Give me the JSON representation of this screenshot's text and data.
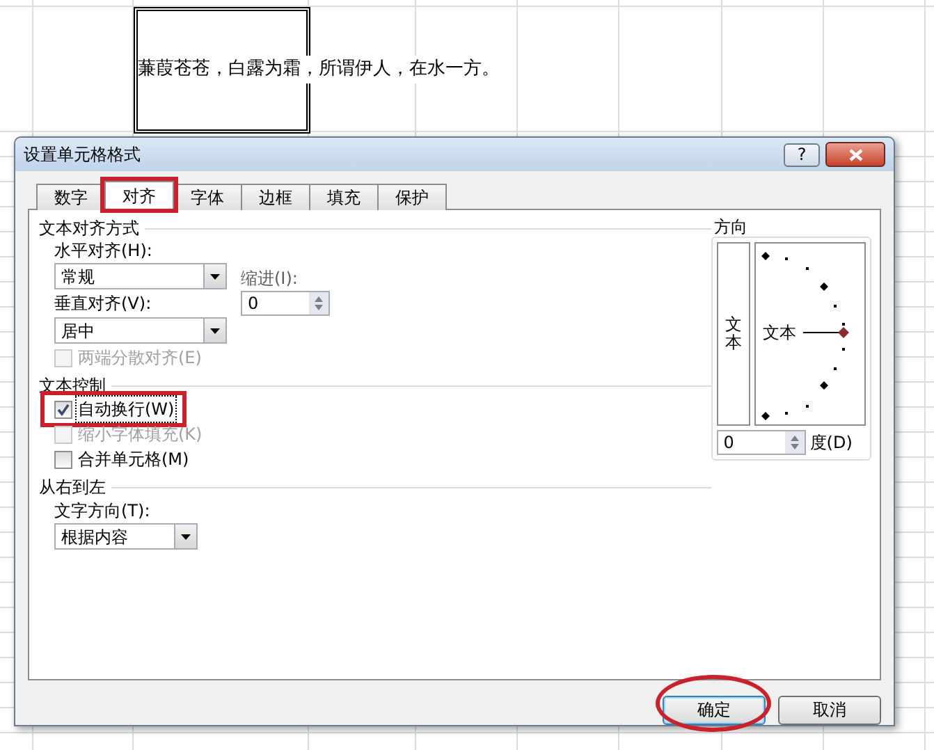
{
  "spreadsheet": {
    "cell_text": "蒹葭苍苍，白露为霜，所谓伊人，在水一方。"
  },
  "dialog": {
    "title": "设置单元格格式",
    "help_button": "?"
  },
  "tabs": [
    {
      "label": "数字",
      "selected": false,
      "highlighted": false
    },
    {
      "label": "对齐",
      "selected": true,
      "highlighted": true
    },
    {
      "label": "字体",
      "selected": false,
      "highlighted": false
    },
    {
      "label": "边框",
      "selected": false,
      "highlighted": false
    },
    {
      "label": "填充",
      "selected": false,
      "highlighted": false
    },
    {
      "label": "保护",
      "selected": false,
      "highlighted": false
    }
  ],
  "text_alignment": {
    "title": "文本对齐方式",
    "horizontal_label": "水平对齐(H):",
    "horizontal_value": "常规",
    "indent_label": "缩进(I):",
    "indent_value": "0",
    "vertical_label": "垂直对齐(V):",
    "vertical_value": "居中",
    "distributed": {
      "label": "两端分散对齐(E)",
      "checked": false,
      "disabled": true
    }
  },
  "text_control": {
    "title": "文本控制",
    "options": [
      {
        "label": "自动换行(W)",
        "checked": true,
        "disabled": false,
        "highlighted": true
      },
      {
        "label": "缩小字体填充(K)",
        "checked": false,
        "disabled": true,
        "highlighted": false
      },
      {
        "label": "合并单元格(M)",
        "checked": false,
        "disabled": false,
        "highlighted": false
      }
    ]
  },
  "right_to_left": {
    "title": "从右到左",
    "direction_label": "文字方向(T):",
    "direction_value": "根据内容"
  },
  "orientation": {
    "title": "方向",
    "vertical_text": "文本",
    "horizontal_text": "文本",
    "degrees_value": "0",
    "degrees_label": "度(D)"
  },
  "buttons": [
    {
      "label": "确定",
      "kind": "primary",
      "highlighted": true
    },
    {
      "label": "取消",
      "kind": "normal",
      "highlighted": false
    }
  ]
}
